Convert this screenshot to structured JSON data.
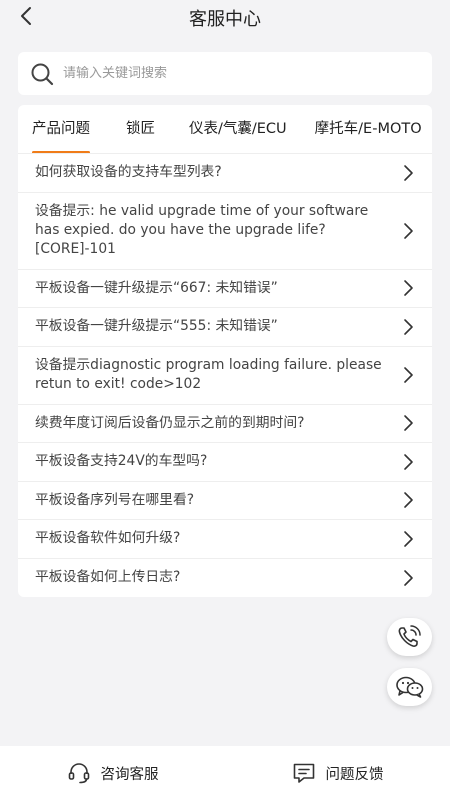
{
  "header": {
    "title": "客服中心",
    "back_icon": "back-arrow-icon"
  },
  "search": {
    "placeholder": "请输入关键词搜索",
    "value": "",
    "icon": "search-icon"
  },
  "tabs": [
    {
      "label": "产品问题",
      "active": true
    },
    {
      "label": "锁匠",
      "active": false
    },
    {
      "label": "仪表/气囊/ECU",
      "active": false
    },
    {
      "label": "摩托车/E-MOTO",
      "active": false
    }
  ],
  "faq": [
    {
      "text": "如何获取设备的支持车型列表?"
    },
    {
      "text": "设备提示: he valid upgrade time of your software has expied. do you have the upgrade life?[CORE]-101"
    },
    {
      "text": "平板设备一键升级提示“667: 未知错误”"
    },
    {
      "text": "平板设备一键升级提示“555: 未知错误”"
    },
    {
      "text": "设备提示diagnostic program loading failure. please retun to exit! code>102"
    },
    {
      "text": "续费年度订阅后设备仍显示之前的到期时间?"
    },
    {
      "text": "平板设备支持24V的车型吗?"
    },
    {
      "text": "平板设备序列号在哪里看?"
    },
    {
      "text": "平板设备软件如何升级?"
    },
    {
      "text": "平板设备如何上传日志?"
    }
  ],
  "floating": {
    "phone_icon": "phone-icon",
    "wechat_icon": "wechat-icon"
  },
  "bottom_bar": {
    "consult_label": "咨询客服",
    "feedback_label": "问题反馈"
  },
  "colors": {
    "accent": "#f07c18",
    "background": "#f3f3f5"
  }
}
